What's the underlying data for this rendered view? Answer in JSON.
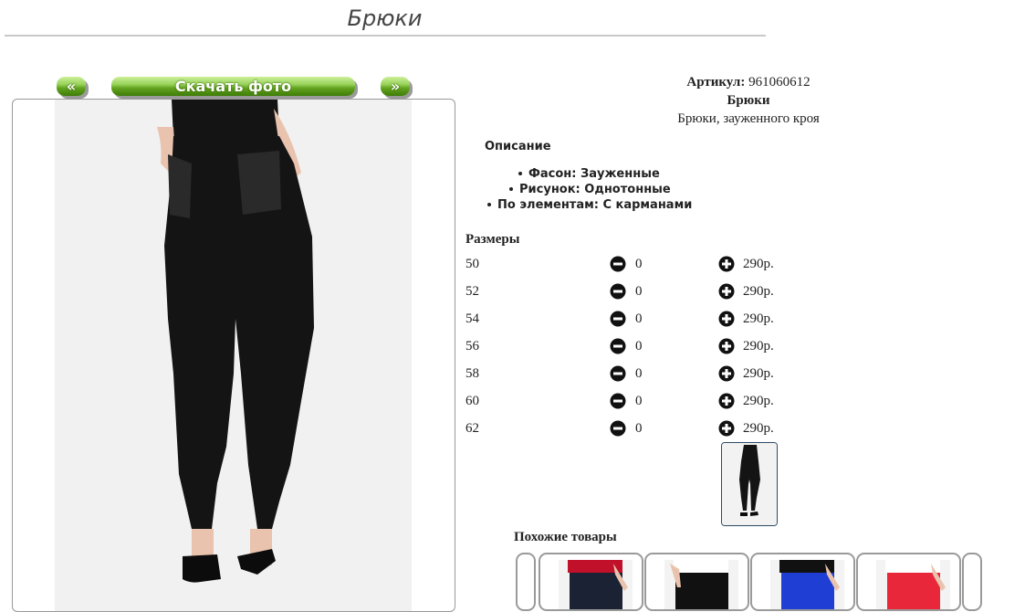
{
  "page": {
    "title": "Брюки"
  },
  "nav": {
    "prev_label": "«",
    "download_label": "Скачать фото",
    "next_label": "»"
  },
  "product": {
    "article_label": "Артикул:",
    "article_value": "961060612",
    "name": "Брюки",
    "subtitle": "Брюки, зауженного кроя"
  },
  "description": {
    "title": "Описание",
    "items": [
      "Фасон: Зауженные",
      "Рисунок: Однотонные",
      "По элементам: С карманами"
    ]
  },
  "sizes": {
    "title": "Размеры",
    "rows": [
      {
        "size": "50",
        "qty": "0",
        "price": "290р."
      },
      {
        "size": "52",
        "qty": "0",
        "price": "290р."
      },
      {
        "size": "54",
        "qty": "0",
        "price": "290р."
      },
      {
        "size": "56",
        "qty": "0",
        "price": "290р."
      },
      {
        "size": "58",
        "qty": "0",
        "price": "290р."
      },
      {
        "size": "60",
        "qty": "0",
        "price": "290р."
      },
      {
        "size": "62",
        "qty": "0",
        "price": "290р."
      }
    ]
  },
  "similar": {
    "title": "Похожие товары",
    "items": [
      {
        "top_color": "#c0102a",
        "pants_color": "#1a2233"
      },
      {
        "top_color": "#ffffff",
        "pants_color": "#111111"
      },
      {
        "top_color": "#111111",
        "pants_color": "#1f3fd4"
      },
      {
        "top_color": "#ffffff",
        "pants_color": "#e8283a"
      }
    ]
  },
  "colors": {
    "button_green": "#62a21e",
    "product_black": "#141414"
  }
}
